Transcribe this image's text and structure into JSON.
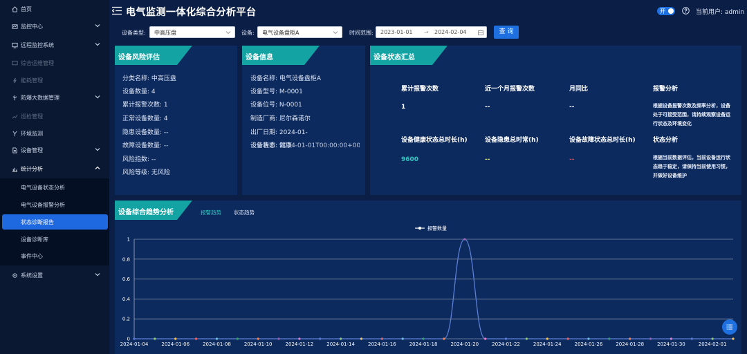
{
  "sidebar": {
    "items": [
      {
        "label": "首页",
        "icon": "home-icon"
      },
      {
        "label": "监控中心",
        "icon": "monitor-icon"
      },
      {
        "label": "远程监控系统",
        "icon": "remote-icon"
      },
      {
        "label": "综合运维管理",
        "icon": "screen-icon"
      },
      {
        "label": "能耗管理",
        "icon": "energy-icon"
      },
      {
        "label": "防爆大数据管理",
        "icon": "data-icon"
      },
      {
        "label": "巡检管理",
        "icon": "inspect-icon"
      },
      {
        "label": "环境监测",
        "icon": "environment-icon"
      },
      {
        "label": "设备管理",
        "icon": "device-icon"
      },
      {
        "label": "统计分析",
        "icon": "stats-icon"
      }
    ],
    "sub_items": [
      {
        "label": "电气设备状态分析"
      },
      {
        "label": "电气设备报警分析"
      },
      {
        "label": "状态诊断报告"
      },
      {
        "label": "设备诊断库"
      },
      {
        "label": "事件中心"
      }
    ],
    "bottom_item": {
      "label": "系统设置",
      "icon": "settings-icon"
    }
  },
  "header": {
    "title": "电气监测一体化综合分析平台",
    "switch_label": "开",
    "user": "当前用户: admin"
  },
  "filters": {
    "device_type_label": "设备类型:",
    "device_type_value": "中高压盘",
    "device_label": "设备:",
    "device_value": "电气设备盘柜A",
    "time_label": "时间范围:",
    "start_date": "2023-01-01",
    "arrow": "→",
    "end_date": "2024-02-04",
    "query_label": "查 询"
  },
  "risk": {
    "title": "设备风险评估",
    "lines": [
      "分类名称: 中高压盘",
      "设备数量: 4",
      "累计报警次数: 1",
      "正常设备数量: 4",
      "隐患设备数量: --",
      "故障设备数量: --",
      "风险指数: --",
      "风险等级: 无风险"
    ]
  },
  "info": {
    "title": "设备信息",
    "lines": [
      "设备名称: 电气设备盘柜A",
      "设备型号: M-0001",
      "设备位号: N-0001",
      "制造厂商: 尼尔森诺尔",
      "出厂日期: 2024-01-"
    ],
    "overlap_a": "设备状态: 健康",
    "overlap_b": "设计寿命: 2034-01-01T00:00:00+00:00"
  },
  "summary": {
    "title": "设备状态汇总",
    "h1": "累计报警次数",
    "h2": "近一个月报警次数",
    "h3": "月同比",
    "h4": "报警分析",
    "v1": "1",
    "v2": "--",
    "v3": "--",
    "desc1": "根据设备报警次数及频率分析，设备处于可接受范围，请持续观察设备运行状态及环境变化",
    "h5": "设备健康状态总时长(h)",
    "h6": "设备隐患总时常(h)",
    "h7": "设备故障状态总时长(h)",
    "h8": "状态分析",
    "v5": "9600",
    "v6": "--",
    "v7": "--",
    "desc2": "根据当前数据评估，当前设备运行状态趋于稳定，请保持当前使用习惯，并做好设备维护",
    "colors": {
      "v5": "#2ec7c0",
      "v6": "#e6d75a",
      "v7": "#e04646"
    }
  },
  "trend": {
    "title": "设备综合趋势分析",
    "tab1": "报警趋势",
    "tab2": "状态趋势"
  },
  "chart_data": {
    "type": "line",
    "series": [
      {
        "name": "报警数量",
        "values": [
          0,
          0,
          0,
          0,
          0,
          0,
          0,
          0,
          0,
          0,
          0,
          0,
          0,
          0,
          0,
          0,
          1,
          0,
          0,
          0,
          0,
          0,
          0,
          0,
          0,
          0,
          0,
          0,
          0,
          0
        ]
      }
    ],
    "x": [
      "2024-01-04",
      "2024-01-05",
      "2024-01-06",
      "2024-01-07",
      "2024-01-08",
      "2024-01-09",
      "2024-01-10",
      "2024-01-11",
      "2024-01-12",
      "2024-01-13",
      "2024-01-14",
      "2024-01-15",
      "2024-01-16",
      "2024-01-17",
      "2024-01-18",
      "2024-01-19",
      "2024-01-20",
      "2024-01-21",
      "2024-01-22",
      "2024-01-23",
      "2024-01-24",
      "2024-01-25",
      "2024-01-26",
      "2024-01-27",
      "2024-01-28",
      "2024-01-29",
      "2024-01-30",
      "2024-01-31",
      "2024-02-01",
      "2024-02-02"
    ],
    "x_tick_labels": [
      "2024-01-04",
      "2024-01-06",
      "2024-01-08",
      "2024-01-10",
      "2024-01-12",
      "2024-01-14",
      "2024-01-16",
      "2024-01-18",
      "2024-01-20",
      "2024-01-22",
      "2024-01-24",
      "2024-01-26",
      "2024-01-28",
      "2024-01-30",
      "2024-02-01"
    ],
    "y_ticks": [
      0,
      0.2,
      0.4,
      0.6,
      0.8,
      1
    ],
    "ylim": [
      0,
      1
    ],
    "grid": true,
    "legend": "top-center",
    "line_color": "#5b7fd6",
    "point_colors": [
      "#5b7fd6",
      "#91cc75",
      "#fac858",
      "#ee6666",
      "#73c0de",
      "#3ba272",
      "#fc8452",
      "#9a60b4",
      "#ea7ccc"
    ]
  },
  "fab": {
    "icon": "list-icon"
  }
}
